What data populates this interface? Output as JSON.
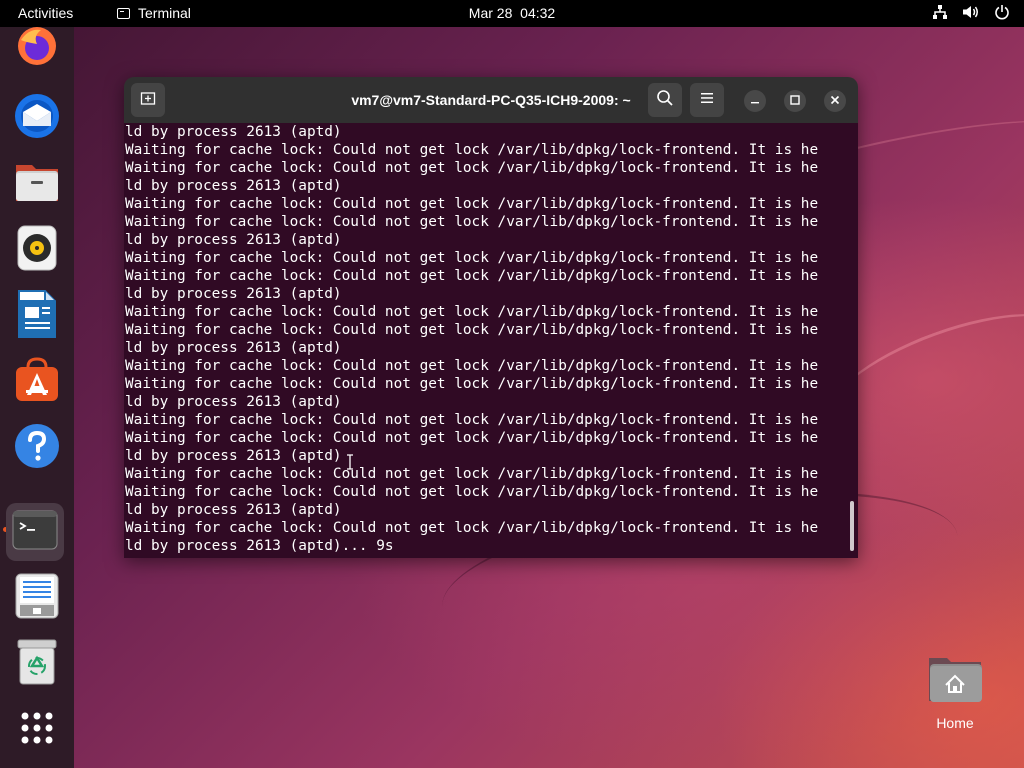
{
  "topbar": {
    "activities": "Activities",
    "app_name": "Terminal",
    "date": "Mar 28",
    "time": "04:32"
  },
  "dock": {
    "items": [
      {
        "name": "Firefox",
        "icon": "firefox-icon"
      },
      {
        "name": "Thunderbird",
        "icon": "thunderbird-icon"
      },
      {
        "name": "Files",
        "icon": "files-icon"
      },
      {
        "name": "Rhythmbox",
        "icon": "rhythmbox-icon"
      },
      {
        "name": "LibreOffice Writer",
        "icon": "writer-icon"
      },
      {
        "name": "Ubuntu Software",
        "icon": "software-icon"
      },
      {
        "name": "Help",
        "icon": "help-icon"
      },
      {
        "name": "Terminal",
        "icon": "terminal-icon",
        "active": true
      },
      {
        "name": "Text Editor",
        "icon": "text-editor-icon"
      },
      {
        "name": "Trash",
        "icon": "trash-icon"
      },
      {
        "name": "Show Applications",
        "icon": "app-grid-icon"
      }
    ]
  },
  "terminal": {
    "title": "vm7@vm7-Standard-PC-Q35-ICH9-2009: ~",
    "lines": [
      "ld by process 2613 (aptd)",
      "Waiting for cache lock: Could not get lock /var/lib/dpkg/lock-frontend. It is he",
      "Waiting for cache lock: Could not get lock /var/lib/dpkg/lock-frontend. It is he",
      "ld by process 2613 (aptd)",
      "Waiting for cache lock: Could not get lock /var/lib/dpkg/lock-frontend. It is he",
      "Waiting for cache lock: Could not get lock /var/lib/dpkg/lock-frontend. It is he",
      "ld by process 2613 (aptd)",
      "Waiting for cache lock: Could not get lock /var/lib/dpkg/lock-frontend. It is he",
      "Waiting for cache lock: Could not get lock /var/lib/dpkg/lock-frontend. It is he",
      "ld by process 2613 (aptd)",
      "Waiting for cache lock: Could not get lock /var/lib/dpkg/lock-frontend. It is he",
      "Waiting for cache lock: Could not get lock /var/lib/dpkg/lock-frontend. It is he",
      "ld by process 2613 (aptd)",
      "Waiting for cache lock: Could not get lock /var/lib/dpkg/lock-frontend. It is he",
      "Waiting for cache lock: Could not get lock /var/lib/dpkg/lock-frontend. It is he",
      "ld by process 2613 (aptd)",
      "Waiting for cache lock: Could not get lock /var/lib/dpkg/lock-frontend. It is he",
      "Waiting for cache lock: Could not get lock /var/lib/dpkg/lock-frontend. It is he",
      "ld by process 2613 (aptd)",
      "Waiting for cache lock: Could not get lock /var/lib/dpkg/lock-frontend. It is he",
      "Waiting for cache lock: Could not get lock /var/lib/dpkg/lock-frontend. It is he",
      "ld by process 2613 (aptd)",
      "Waiting for cache lock: Could not get lock /var/lib/dpkg/lock-frontend. It is he",
      "ld by process 2613 (aptd)... 9s"
    ]
  },
  "desktop": {
    "home_label": "Home"
  },
  "colors": {
    "terminal_bg": "#300a24",
    "titlebar_bg": "#303030",
    "accent": "#e95420"
  }
}
